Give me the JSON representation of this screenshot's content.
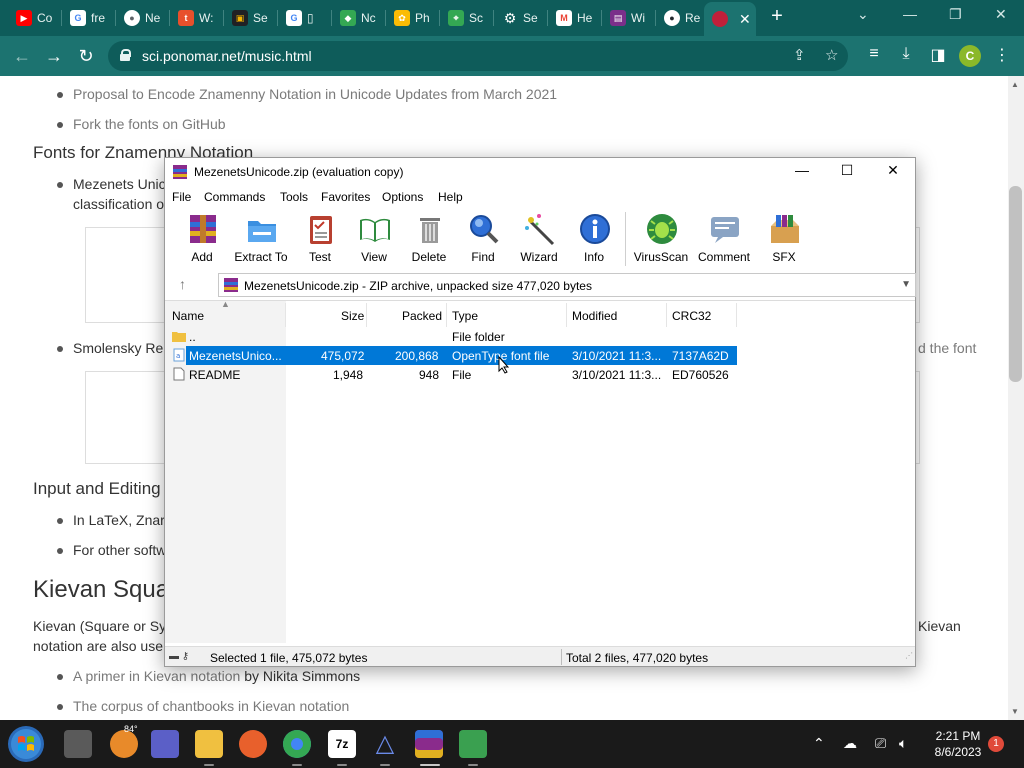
{
  "browser": {
    "tabs": [
      {
        "label": "Co",
        "icon": "youtube-icon",
        "color": "#ff0000"
      },
      {
        "label": "fre",
        "icon": "google-icon",
        "color": "#4285f4"
      },
      {
        "label": "Ne",
        "icon": "chrome-icon",
        "color": "#5f6368"
      },
      {
        "label": "W:",
        "icon": "tumblr-icon",
        "color": "#e8502c"
      },
      {
        "label": "Se",
        "icon": "search-engine-icon",
        "color": "#202124"
      },
      {
        "label": "",
        "icon": "google-icon",
        "color": "#4285f4"
      },
      {
        "label": "Nc",
        "icon": "notion-icon",
        "color": "#34a853"
      },
      {
        "label": "Ph",
        "icon": "photos-icon",
        "color": "#fbbc04"
      },
      {
        "label": "Sc",
        "icon": "maps-icon",
        "color": "#34a853"
      },
      {
        "label": "Se",
        "icon": "settings-icon",
        "color": "#5f6368"
      },
      {
        "label": "He",
        "icon": "gmail-icon",
        "color": "#ea4335"
      },
      {
        "label": "Wi",
        "icon": "winrar-icon",
        "color": "#7a2f8a"
      },
      {
        "label": "Re",
        "icon": "github-icon",
        "color": "#24292e"
      },
      {
        "label": "",
        "icon": "active-site-icon",
        "color": "#c0203a"
      }
    ],
    "url": "sci.ponomar.net/music.html",
    "profile_initial": "C"
  },
  "page": {
    "links": [
      "Proposal to Encode Znamenny Notation in Unicode Updates from March 2021",
      "Fork the fonts on GitHub"
    ],
    "heading_fonts": "Fonts for Znamenny Notation",
    "mezenets_item": "Mezenets Unic",
    "classification": "classification o",
    "smolensky_item": "Smolensky Re",
    "the_font": "d the font",
    "heading_input": "Input and Editing",
    "latex_item": "In LaTeX, Znar",
    "other_item": "For other softw",
    "heading_kievan": "Kievan Squa",
    "kievan_para_1": "Kievan (Square or Sy",
    "kievan_para_right": "Kievan",
    "kievan_para_2": "notation are also use",
    "primer_link": "A primer in Kievan notation",
    "primer_author": " by Nikita Simmons",
    "corpus_link": "The corpus of chantbooks in Kievan notation"
  },
  "winrar": {
    "title": "MezenetsUnicode.zip (evaluation copy)",
    "menu": [
      "File",
      "Commands",
      "Tools",
      "Favorites",
      "Options",
      "Help"
    ],
    "toolbar": [
      "Add",
      "Extract To",
      "Test",
      "View",
      "Delete",
      "Find",
      "Wizard",
      "Info",
      "VirusScan",
      "Comment",
      "SFX"
    ],
    "path": "MezenetsUnicode.zip - ZIP archive, unpacked size 477,020 bytes",
    "columns": [
      "Name",
      "Size",
      "Packed",
      "Type",
      "Modified",
      "CRC32"
    ],
    "rows": [
      {
        "name": "..",
        "size": "",
        "packed": "",
        "type": "File folder",
        "modified": "",
        "crc": ""
      },
      {
        "name": "MezenetsUnico...",
        "size": "475,072",
        "packed": "200,868",
        "type": "OpenType font file",
        "modified": "3/10/2021 11:3...",
        "crc": "7137A62D"
      },
      {
        "name": "README",
        "size": "1,948",
        "packed": "948",
        "type": "File",
        "modified": "3/10/2021 11:3...",
        "crc": "ED760526"
      }
    ],
    "status_left": "Selected 1 file, 475,072 bytes",
    "status_right": "Total 2 files, 477,020 bytes"
  },
  "taskbar": {
    "weather_temp": "84°",
    "time": "2:21 PM",
    "date": "8/6/2023",
    "notifications": "1"
  },
  "colors": {
    "chrome_frame": "#0e5c5a",
    "chrome_toolbar": "#1c7370",
    "selection": "#0078d7",
    "taskbar": "#1a1a1a"
  }
}
